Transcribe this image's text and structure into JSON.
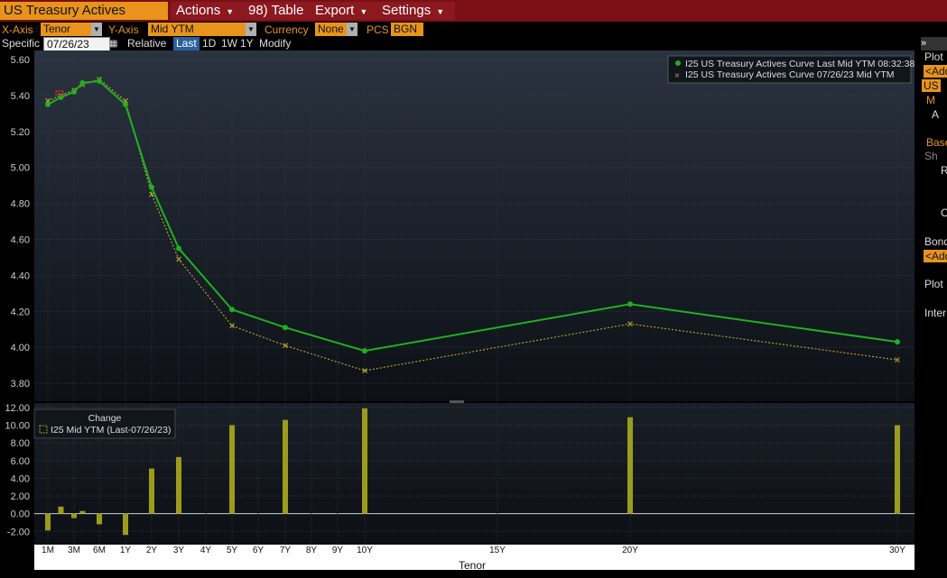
{
  "menubar": {
    "title": "US Treasury Actives Curve",
    "actions": "Actions",
    "table": "98) Table",
    "export": "Export",
    "settings": "Settings"
  },
  "controls": {
    "xaxis_label": "X-Axis",
    "xaxis_value": "Tenor",
    "yaxis_label": "Y-Axis",
    "yaxis_value": "Mid YTM",
    "currency_label": "Currency",
    "currency_value": "None",
    "pcs_label": "PCS",
    "pcs_value": "BGN",
    "specific_label": "Specific",
    "specific_date": "07/26/23",
    "relative_label": "Relative",
    "last": "Last",
    "d1": "1D",
    "w1": "1W",
    "y1": "1Y",
    "modify": "Modify"
  },
  "sidebar": {
    "toggle": "»",
    "plot": "Plot",
    "add1": "<Add",
    "us": "US",
    "m": "M",
    "a": "A",
    "base": "Base",
    "sh": "Sh",
    "r": "R",
    "o": "O",
    "bond": "Bond",
    "add2": "<Add",
    "plot2": "Plot",
    "inter": "Inter"
  },
  "colors": {
    "current": "#20b020",
    "previous": "#b0a030",
    "bars": "#9c9c1c",
    "menubar": "#7a0f16",
    "accent": "#e8941c"
  },
  "chart_data": {
    "type": "line",
    "xlabel": "Tenor",
    "top_panel": {
      "ylim": [
        3.7,
        5.65
      ],
      "yticks": [
        "5.60",
        "5.40",
        "5.20",
        "5.00",
        "4.80",
        "4.60",
        "4.40",
        "4.20",
        "4.00",
        "3.80"
      ],
      "legend_position": "top-right",
      "series": [
        {
          "name": "I25 US Treasury Actives Curve Last Mid YTM 08:32:38",
          "color": "#20b020",
          "points": [
            {
              "tenor": "1M",
              "y": 5.35
            },
            {
              "tenor": "2M",
              "y": 5.39
            },
            {
              "tenor": "3M",
              "y": 5.42
            },
            {
              "tenor": "4M",
              "y": 5.47
            },
            {
              "tenor": "6M",
              "y": 5.48
            },
            {
              "tenor": "1Y",
              "y": 5.35
            },
            {
              "tenor": "2Y",
              "y": 4.89
            },
            {
              "tenor": "3Y",
              "y": 4.55
            },
            {
              "tenor": "5Y",
              "y": 4.21
            },
            {
              "tenor": "7Y",
              "y": 4.11
            },
            {
              "tenor": "10Y",
              "y": 3.98
            },
            {
              "tenor": "20Y",
              "y": 4.24
            },
            {
              "tenor": "30Y",
              "y": 4.03
            }
          ]
        },
        {
          "name": "I25 US Treasury Actives Curve 07/26/23 Mid YTM",
          "color": "#b0a030",
          "points": [
            {
              "tenor": "1M",
              "y": 5.37
            },
            {
              "tenor": "2M",
              "y": 5.4
            },
            {
              "tenor": "3M",
              "y": 5.43
            },
            {
              "tenor": "4M",
              "y": 5.46
            },
            {
              "tenor": "6M",
              "y": 5.49
            },
            {
              "tenor": "1Y",
              "y": 5.37
            },
            {
              "tenor": "2Y",
              "y": 4.85
            },
            {
              "tenor": "3Y",
              "y": 4.49
            },
            {
              "tenor": "5Y",
              "y": 4.12
            },
            {
              "tenor": "7Y",
              "y": 4.01
            },
            {
              "tenor": "10Y",
              "y": 3.87
            },
            {
              "tenor": "20Y",
              "y": 4.13
            },
            {
              "tenor": "30Y",
              "y": 3.93
            }
          ]
        }
      ]
    },
    "bottom_panel": {
      "title": "Change",
      "legend": "I25 Mid YTM (Last-07/26/23)",
      "ylim": [
        -3.5,
        12.5
      ],
      "yticks": [
        "12.00",
        "10.00",
        "8.00",
        "6.00",
        "4.00",
        "2.00",
        "0.00",
        "-2.00"
      ],
      "bars": [
        {
          "tenor": "1M",
          "value": -1.9
        },
        {
          "tenor": "2M",
          "value": 0.8
        },
        {
          "tenor": "3M",
          "value": -0.5
        },
        {
          "tenor": "4M",
          "value": 0.3
        },
        {
          "tenor": "6M",
          "value": -1.2
        },
        {
          "tenor": "1Y",
          "value": -2.4
        },
        {
          "tenor": "2Y",
          "value": 5.1
        },
        {
          "tenor": "3Y",
          "value": 6.4
        },
        {
          "tenor": "5Y",
          "value": 10.0
        },
        {
          "tenor": "7Y",
          "value": 10.6
        },
        {
          "tenor": "10Y",
          "value": 11.9
        },
        {
          "tenor": "20Y",
          "value": 10.9
        },
        {
          "tenor": "30Y",
          "value": 10.0
        }
      ]
    },
    "x_ticks": [
      "1M",
      "3M",
      "6M",
      "1Y",
      "2Y",
      "3Y",
      "4Y",
      "5Y",
      "6Y",
      "7Y",
      "8Y",
      "9Y",
      "10Y",
      "15Y",
      "20Y",
      "30Y"
    ]
  }
}
